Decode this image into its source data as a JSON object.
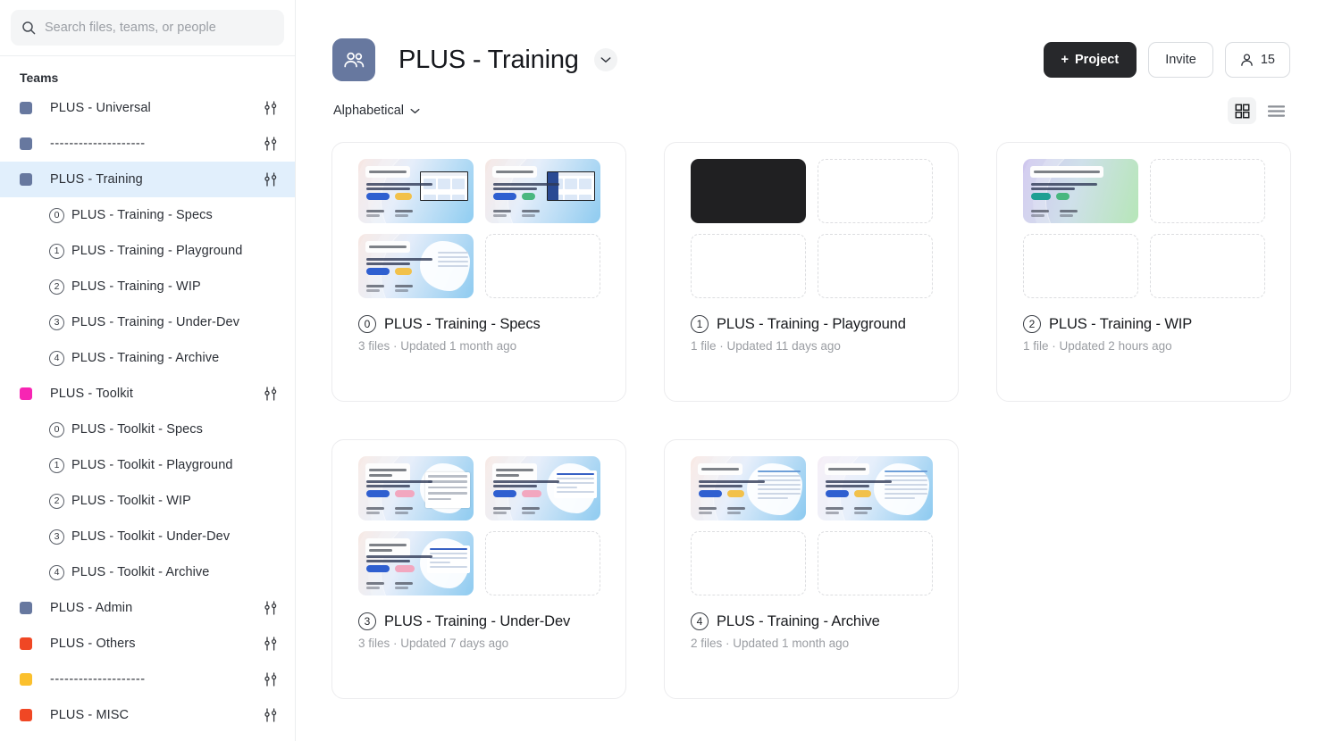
{
  "sidebar": {
    "search": {
      "placeholder": "Search files, teams, or people",
      "value": "",
      "icon": "search-icon"
    },
    "section_title": "Teams",
    "items": [
      {
        "kind": "team",
        "label": "PLUS - Universal",
        "color": "#67789f",
        "active": false
      },
      {
        "kind": "team",
        "label": "--------------------",
        "color": "#67789f",
        "active": false
      },
      {
        "kind": "team",
        "label": "PLUS - Training",
        "color": "#67789f",
        "active": true
      },
      {
        "kind": "project",
        "num": "0",
        "label": "PLUS - Training - Specs"
      },
      {
        "kind": "project",
        "num": "1",
        "label": "PLUS - Training - Playground"
      },
      {
        "kind": "project",
        "num": "2",
        "label": "PLUS - Training - WIP"
      },
      {
        "kind": "project",
        "num": "3",
        "label": "PLUS - Training - Under-Dev"
      },
      {
        "kind": "project",
        "num": "4",
        "label": "PLUS - Training - Archive"
      },
      {
        "kind": "team",
        "label": "PLUS - Toolkit",
        "color": "#f725b3",
        "active": false
      },
      {
        "kind": "project",
        "num": "0",
        "label": "PLUS - Toolkit - Specs"
      },
      {
        "kind": "project",
        "num": "1",
        "label": "PLUS - Toolkit - Playground"
      },
      {
        "kind": "project",
        "num": "2",
        "label": "PLUS - Toolkit - WIP"
      },
      {
        "kind": "project",
        "num": "3",
        "label": "PLUS - Toolkit - Under-Dev"
      },
      {
        "kind": "project",
        "num": "4",
        "label": "PLUS - Toolkit - Archive"
      },
      {
        "kind": "team",
        "label": "PLUS - Admin",
        "color": "#67789f",
        "active": false
      },
      {
        "kind": "team",
        "label": "PLUS - Others",
        "color": "#f04724",
        "active": false
      },
      {
        "kind": "team",
        "label": "--------------------",
        "color": "#fbc02d",
        "active": false
      },
      {
        "kind": "team",
        "label": "PLUS - MISC",
        "color": "#f04724",
        "active": false
      }
    ]
  },
  "header": {
    "avatar_icon": "team-people-icon",
    "title": "PLUS - Training",
    "title_chevron_icon": "chevron-down-icon",
    "new_project_label": "Project",
    "new_project_plus": "+",
    "invite_label": "Invite",
    "members_icon": "person-icon",
    "members_count": "15"
  },
  "toolbar": {
    "sort_label": "Alphabetical",
    "sort_chevron_icon": "chevron-down-icon",
    "grid_view_icon": "grid-view-icon",
    "list_view_icon": "list-view-icon",
    "grid_view_selected": true
  },
  "projects": [
    {
      "num": "0",
      "name": "PLUS - Training - Specs",
      "meta": "3 files · Updated 1 month ago",
      "thumbs": [
        "slide-a",
        "slide-b",
        "slide-c",
        "empty"
      ]
    },
    {
      "num": "1",
      "name": "PLUS - Training - Playground",
      "meta": "1 file · Updated 11 days ago",
      "thumbs": [
        "dark",
        "empty",
        "empty",
        "empty"
      ]
    },
    {
      "num": "2",
      "name": "PLUS - Training - WIP",
      "meta": "1 file · Updated 2 hours ago",
      "thumbs": [
        "slide-d",
        "empty",
        "empty",
        "empty"
      ]
    },
    {
      "num": "3",
      "name": "PLUS - Training - Under-Dev",
      "meta": "3 files · Updated 7 days ago",
      "thumbs": [
        "slide-e",
        "slide-f",
        "slide-g",
        "empty"
      ]
    },
    {
      "num": "4",
      "name": "PLUS - Training - Archive",
      "meta": "2 files · Updated 1 month ago",
      "thumbs": [
        "slide-h",
        "slide-i",
        "empty",
        "empty"
      ]
    }
  ],
  "colors": {
    "active_row": "#e1effc",
    "primary_button": "#27282b",
    "avatar": "#67789f",
    "muted_text": "#9a9da2"
  }
}
